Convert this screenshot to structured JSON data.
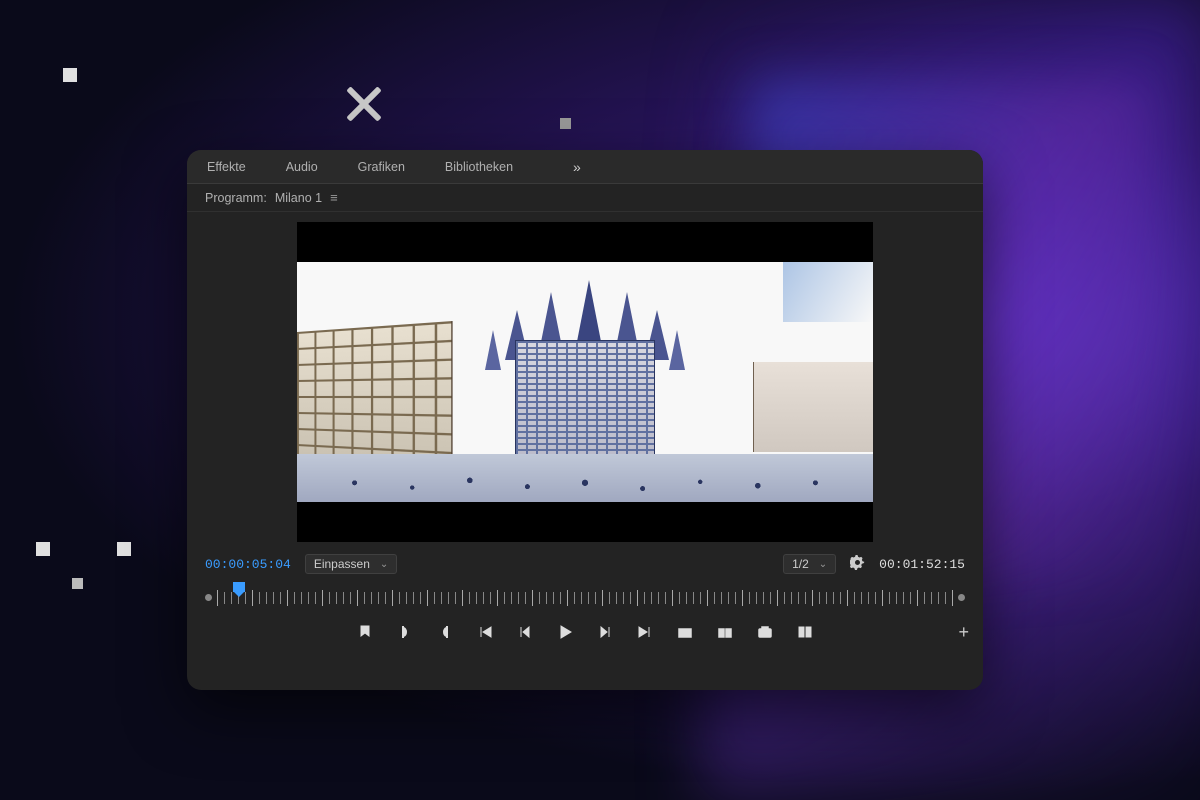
{
  "tabs": {
    "effects": "Effekte",
    "audio": "Audio",
    "graphics": "Grafiken",
    "libraries": "Bibliotheken"
  },
  "program": {
    "label_prefix": "Programm:",
    "sequence_name": "Milano 1"
  },
  "timecode": {
    "current": "00:00:05:04",
    "duration": "00:01:52:15"
  },
  "zoom": {
    "fit_label": "Einpassen"
  },
  "resolution": {
    "label": "1/2"
  },
  "icons": {
    "overflow": "»",
    "hamburger": "≡",
    "wrench": "🔧",
    "plus": "+"
  },
  "transport": {
    "marker": "marker-icon",
    "in": "mark-in-icon",
    "out": "mark-out-icon",
    "go_in": "go-to-in-icon",
    "step_back": "step-back-icon",
    "play": "play-icon",
    "step_fwd": "step-forward-icon",
    "go_out": "go-to-out-icon",
    "lift": "lift-icon",
    "extract": "extract-icon",
    "export": "export-frame-icon",
    "compare": "comparison-view-icon"
  }
}
